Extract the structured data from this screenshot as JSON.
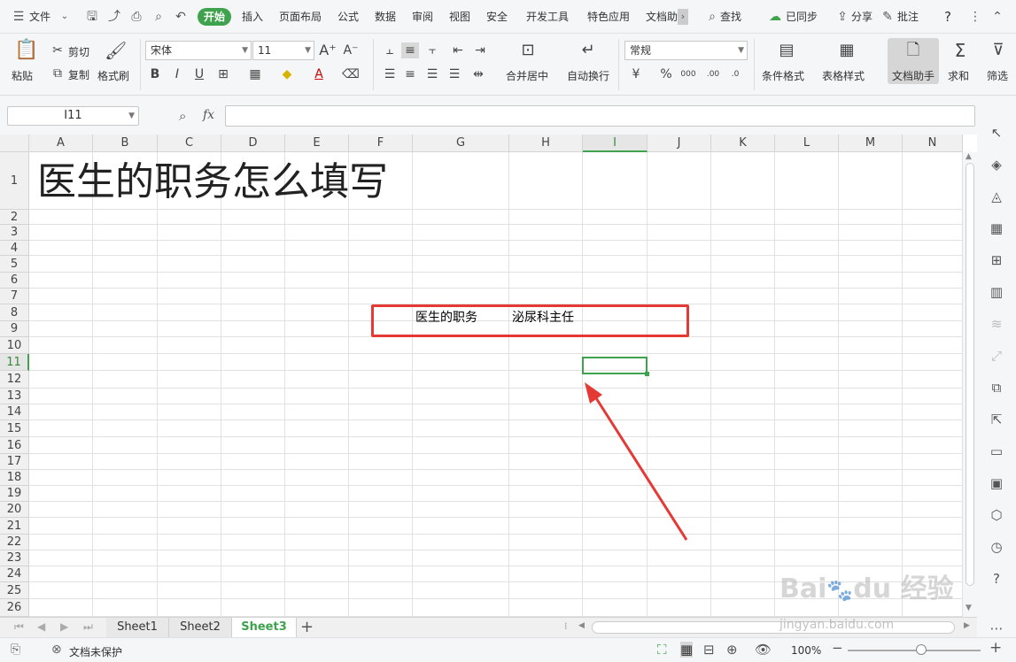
{
  "menu": {
    "file": "文件",
    "tabs": [
      "开始",
      "插入",
      "页面布局",
      "公式",
      "数据",
      "审阅",
      "视图",
      "安全",
      "开发工具",
      "特色应用",
      "文档助"
    ],
    "search": "查找",
    "sync": "已同步",
    "share": "分享",
    "comment": "批注",
    "help": "?"
  },
  "ribbon": {
    "paste": "粘贴",
    "cut": "剪切",
    "copy": "复制",
    "format_painter": "格式刷",
    "font_name": "宋体",
    "font_size": "11",
    "merge_center": "合并居中",
    "wrap_text": "自动换行",
    "number_format": "常规",
    "conditional_format": "条件格式",
    "table_style": "表格样式",
    "doc_assistant": "文档助手",
    "sum": "求和",
    "filter": "筛选"
  },
  "formula_bar": {
    "name_box": "I11",
    "fx": "fx",
    "content": ""
  },
  "columns": [
    "A",
    "B",
    "C",
    "D",
    "E",
    "F",
    "G",
    "H",
    "I",
    "J",
    "K",
    "L",
    "M",
    "N"
  ],
  "active_column": "I",
  "rows": [
    "1",
    "2",
    "3",
    "4",
    "5",
    "6",
    "7",
    "8",
    "9",
    "10",
    "11",
    "12",
    "13",
    "14",
    "15",
    "16",
    "17",
    "18",
    "19",
    "20",
    "21",
    "22",
    "23",
    "24",
    "25",
    "26"
  ],
  "active_row": "11",
  "cells": {
    "A1": "医生的职务怎么填写",
    "G8": "医生的职务",
    "H8": "泌尿科主任"
  },
  "sheets": [
    "Sheet1",
    "Sheet2",
    "Sheet3"
  ],
  "active_sheet": "Sheet3",
  "status": {
    "protect": "文档未保护",
    "zoom": "100%"
  },
  "watermark": "Baidu经验 jingyan.baidu.com",
  "colors": {
    "accent": "#3fa34d",
    "highlight_box": "#e53935"
  }
}
